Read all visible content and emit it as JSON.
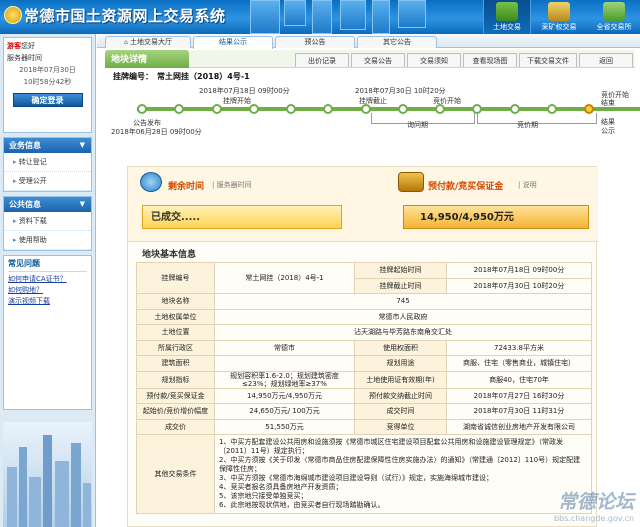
{
  "header": {
    "title": "常德市国土资源网上交易系统",
    "nav": [
      {
        "label": "土地交易",
        "icon": "land-trade-icon",
        "active": true
      },
      {
        "label": "采矿权交易",
        "icon": "mining-icon",
        "active": false
      },
      {
        "label": "全省交易所",
        "icon": "province-icon",
        "active": false
      }
    ]
  },
  "sidebar": {
    "login": {
      "greeting": "游客",
      "greeting_suffix": "您好",
      "server_time_label": "服务器时间",
      "date": "2018年07月30日",
      "time": "10时58分42秒",
      "button": "确定登录"
    },
    "business": {
      "title": "业务信息",
      "items": [
        "转让登记",
        "受理公开"
      ]
    },
    "public": {
      "title": "公共信息",
      "items": [
        "资料下载",
        "使用帮助"
      ]
    },
    "faq": {
      "title": "常见问题",
      "links": [
        "如何申请CA证书？",
        "如何购地？",
        "演示视频下载"
      ]
    }
  },
  "tabs": [
    {
      "label": "土地交易大厅",
      "prefix": "⌂",
      "active": false
    },
    {
      "label": "结果公示",
      "active": true
    },
    {
      "label": "预公告",
      "active": false
    },
    {
      "label": "其它公告",
      "active": false
    }
  ],
  "subnav": {
    "title": "地块详情",
    "buttons": [
      "出价记录",
      "交易公告",
      "交易须知",
      "查看现场图",
      "下载交易文件",
      "返回"
    ]
  },
  "lot": {
    "label": "挂牌编号：",
    "number": "常土网挂（2018）4号-1"
  },
  "timeline": {
    "top_time_1": "2018年07月18日 09时00分",
    "top_time_2": "2018年07月30日 10时20分",
    "above_1": "挂牌开始",
    "above_2": "挂牌截止",
    "above_3": "竞价开始",
    "above_4": "竞价开始",
    "above_5": "结束",
    "start_label": "公告发布",
    "start_time": "2018年06月28日 09时00分",
    "below_1": "询问期",
    "below_2": "竞价期",
    "below_3": "结果",
    "below_4": "公示"
  },
  "status": {
    "remaining_label": "剩余时间",
    "server_time_label": "| 服务器时间",
    "result": "已成交.....",
    "deposit_label": "预付款/竞买保证金",
    "deposit_unit": "| 说明",
    "deposit": "14,950/4,950万元"
  },
  "basic_info": {
    "title": "地块基本信息",
    "listing_code_label": "挂牌编号",
    "listing_code": "常土网挂（2018）4号-1",
    "listing_start_label": "挂牌起始时间",
    "listing_start": "2018年07月18日 09时00分",
    "listing_end_label": "挂牌截止时间",
    "listing_end": "2018年07月30日 10时20分",
    "parcel_name_label": "地块名称",
    "parcel_name": "745",
    "owner_label": "土地权属单位",
    "owner": "常德市人民政府",
    "location_label": "土地位置",
    "location": "沾天湖路与毕芳路东南角交汇处",
    "district_label": "所属行政区",
    "district": "常德市",
    "area_label": "使用权面积",
    "area": "72433.8平方米",
    "building_area_label": "建筑面积",
    "building_area": "",
    "purpose_label": "规划用途",
    "purpose": "商服、住宅（零售商业，城镇住宅）",
    "plan_label": "规划指标",
    "plan": "规划容积率1.6-2.0；规划建筑密度≤23%；规划绿地率≥37%",
    "term_label": "土地使用证有效期(年)",
    "term": "商服40，住宅70年",
    "deposit_label": "预付款/竞买保证金",
    "deposit": "14,950万元/4,950万元",
    "deposit_deadline_label": "预付款交纳截止时间",
    "deposit_deadline": "2018年07月27日 16时30分",
    "start_price_label": "起始价/竞价增价幅度",
    "start_price": "24,650万元/ 100万元",
    "deal_time_label": "成交时间",
    "deal_time": "2018年07月30日 11时31分",
    "deal_price_label": "成交价",
    "deal_price": "51,550万元",
    "buyer_label": "竞得单位",
    "buyer": "湖南省诚信创业房地产开发有限公司",
    "other_label": "其他交易条件",
    "other": [
      "1、中买方配套建设公共用房和设施须按《常德市城区住宅建设项目配套公共用房和设施建设管理规定》（常政发〔2011〕11号）规定执行；",
      "2、中买方须按《关于印发〈常德市商品住房配建保障性住房实施办法〉的通知》（常建通〔2012〕110号）规定配建保障性住房；",
      "3、中买方须按《常德市海绵城市建设项目建设导则（试行）》规定，实施海绵城市建设；",
      "4、竞买者报名须具备房地产开发资质；",
      "5、该宗地只接受单独竞买；",
      "6、此宗地按现状供地，由竞买者自行现场踏勘确认。"
    ]
  },
  "watermark": {
    "text": "常德论坛",
    "url": "bbs.changde.gov.cn"
  }
}
